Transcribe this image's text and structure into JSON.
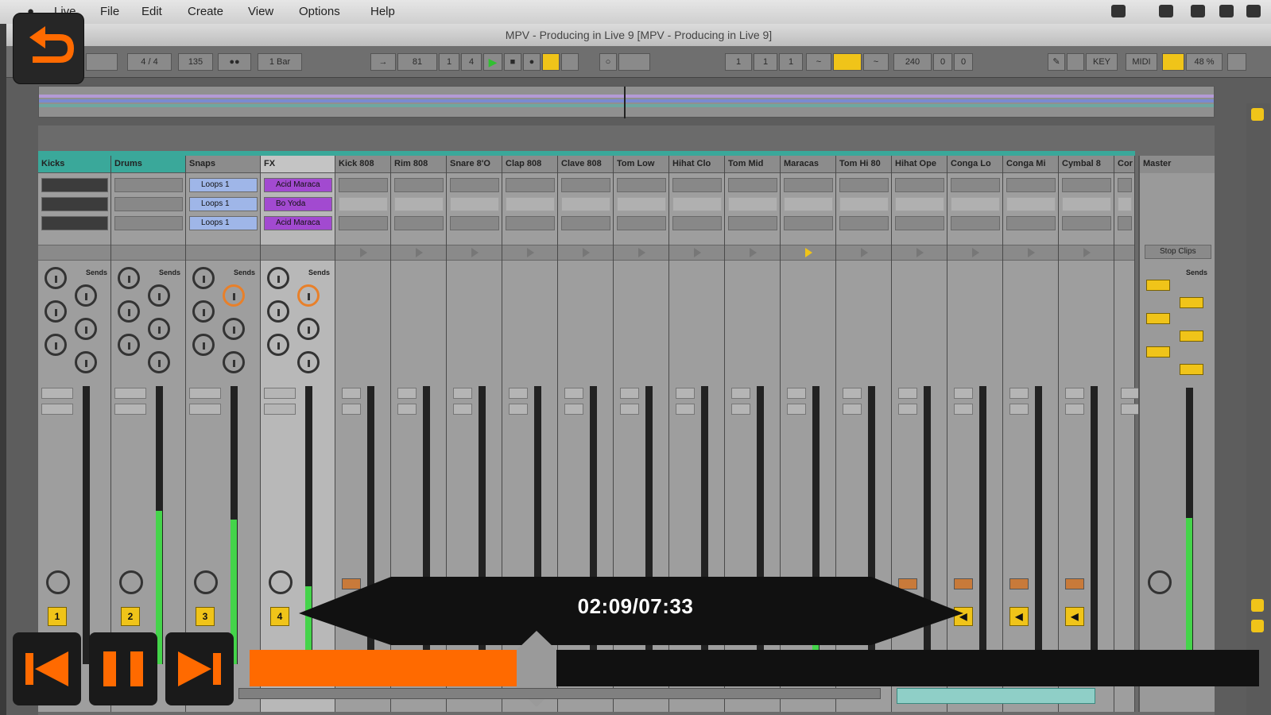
{
  "menubar": {
    "items": [
      "Live",
      "File",
      "Edit",
      "Create",
      "View",
      "Options",
      "Help"
    ]
  },
  "window": {
    "title": "MPV - Producing in Live 9 [MPV - Producing in Live 9]"
  },
  "controlbar": {
    "time_signature": "4 / 4",
    "quantize": "1 Bar",
    "tempo_display": "135",
    "arrangement_position": [
      "81",
      "1",
      "4"
    ],
    "loop_start": [
      "1",
      "1",
      "1"
    ],
    "key_label": "KEY",
    "midi_label": "MIDI",
    "cpu_label": "48 %",
    "loop_length": [
      "240",
      "0",
      "0"
    ],
    "accent": "#f0c419"
  },
  "tracks": [
    {
      "name": "Kicks",
      "color": "teal",
      "number": "1",
      "clips": [
        "",
        "",
        ""
      ]
    },
    {
      "name": "Drums",
      "color": "teal",
      "number": "2",
      "clips": [
        "",
        "",
        ""
      ]
    },
    {
      "name": "Snaps",
      "color": "grey",
      "number": "3",
      "clips": [
        "Loops 1",
        "Loops 1",
        "Loops 1"
      ]
    },
    {
      "name": "FX",
      "color": "sel",
      "number": "4",
      "clips": [
        "Acid Maraca",
        "Bo Yoda",
        "Acid Maraca"
      ]
    },
    {
      "name": "Kick 808",
      "color": "grey"
    },
    {
      "name": "Rim 808",
      "color": "grey"
    },
    {
      "name": "Snare 8'O",
      "color": "grey"
    },
    {
      "name": "Clap 808",
      "color": "grey"
    },
    {
      "name": "Clave 808",
      "color": "grey"
    },
    {
      "name": "Tom Low",
      "color": "grey"
    },
    {
      "name": "Hihat Clo",
      "color": "grey"
    },
    {
      "name": "Tom Mid",
      "color": "grey"
    },
    {
      "name": "Maracas",
      "color": "grey"
    },
    {
      "name": "Tom Hi 80",
      "color": "grey"
    },
    {
      "name": "Hihat Ope",
      "color": "grey"
    },
    {
      "name": "Conga Lo",
      "color": "grey"
    },
    {
      "name": "Conga Mi",
      "color": "grey"
    },
    {
      "name": "Cymbal 8",
      "color": "grey"
    },
    {
      "name": "Cor",
      "color": "grey"
    }
  ],
  "master": {
    "name": "Master",
    "stop_clips": "Stop Clips",
    "sends": "Sends"
  },
  "sends_label": "Sends",
  "player": {
    "time": "02:09/07:33",
    "progress": 0.284,
    "accent": "#ff6a00"
  }
}
